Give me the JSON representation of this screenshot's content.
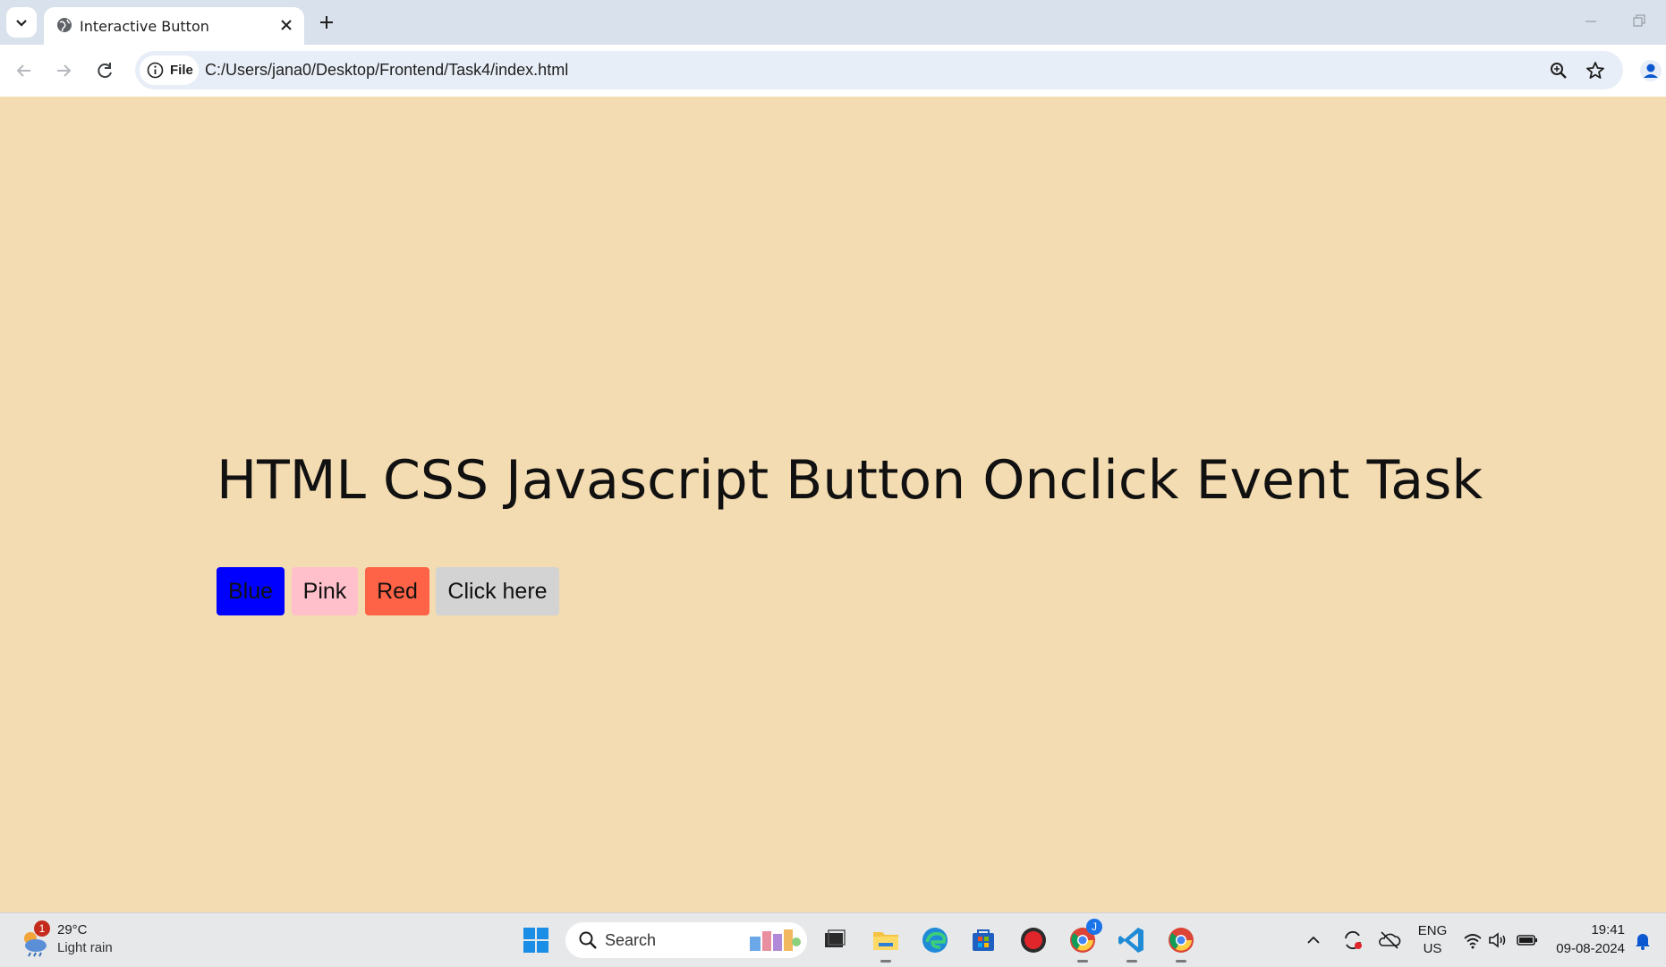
{
  "browser": {
    "tab_title": "Interactive Button",
    "site_chip_label": "File",
    "url": "C:/Users/jana0/Desktop/Frontend/Task4/index.html"
  },
  "page": {
    "heading": "HTML CSS Javascript Button Onclick Event Task",
    "background_color": "#f3dcb1",
    "buttons": [
      {
        "label": "Blue",
        "color": "#0000ff"
      },
      {
        "label": "Pink",
        "color": "#ffc0cb"
      },
      {
        "label": "Red",
        "color": "#ff6347"
      },
      {
        "label": "Click here",
        "color": "#d3d3d3"
      }
    ]
  },
  "taskbar": {
    "weather_badge": "1",
    "weather_temp": "29°C",
    "weather_condition": "Light rain",
    "search_label": "Search",
    "language": "ENG",
    "region": "US",
    "time": "19:41",
    "date": "09-08-2024",
    "profile_badge": "J"
  }
}
